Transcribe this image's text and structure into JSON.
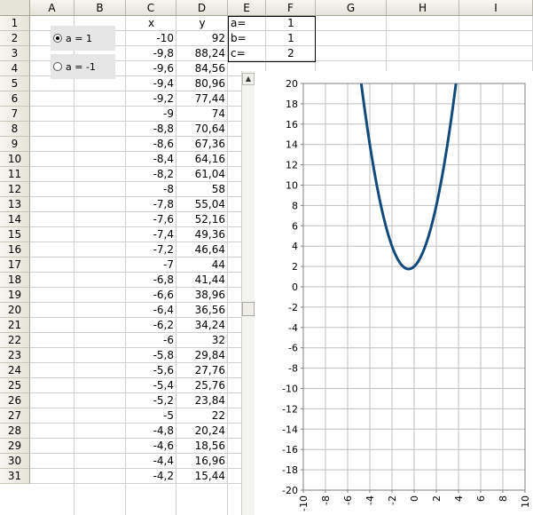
{
  "columns": [
    "A",
    "B",
    "C",
    "D",
    "E",
    "F",
    "G",
    "H",
    "I"
  ],
  "rows": [
    "1",
    "2",
    "3",
    "4",
    "5",
    "6",
    "7",
    "8",
    "9",
    "10",
    "11",
    "12",
    "13",
    "14",
    "15",
    "16",
    "17",
    "18",
    "19",
    "20",
    "21",
    "22",
    "23",
    "24",
    "25",
    "26",
    "27",
    "28",
    "29",
    "30",
    "31"
  ],
  "header_cells": {
    "x": "x",
    "y": "y"
  },
  "params": [
    {
      "label": "a=",
      "value": "1"
    },
    {
      "label": "b=",
      "value": "1"
    },
    {
      "label": "c=",
      "value": "2"
    }
  ],
  "table": {
    "x": [
      "-10",
      "-9,8",
      "-9,6",
      "-9,4",
      "-9,2",
      "-9",
      "-8,8",
      "-8,6",
      "-8,4",
      "-8,2",
      "-8",
      "-7,8",
      "-7,6",
      "-7,4",
      "-7,2",
      "-7",
      "-6,8",
      "-6,6",
      "-6,4",
      "-6,2",
      "-6",
      "-5,8",
      "-5,6",
      "-5,4",
      "-5,2",
      "-5",
      "-4,8",
      "-4,6",
      "-4,4",
      "-4,2"
    ],
    "y": [
      "92",
      "88,24",
      "84,56",
      "80,96",
      "77,44",
      "74",
      "70,64",
      "67,36",
      "64,16",
      "61,04",
      "58",
      "55,04",
      "52,16",
      "49,36",
      "46,64",
      "44",
      "41,44",
      "38,96",
      "36,56",
      "34,24",
      "32",
      "29,84",
      "27,76",
      "25,76",
      "23,84",
      "22",
      "20,24",
      "18,56",
      "16,96",
      "15,44"
    ]
  },
  "radio": [
    {
      "label": "a = 1",
      "checked": true
    },
    {
      "label": "a = -1",
      "checked": false
    }
  ],
  "scrollbar": {
    "up_icon": "triangle-up-icon",
    "down_icon": "triangle-down-icon"
  },
  "chart_data": {
    "type": "line",
    "function": {
      "a": 1,
      "b": 1,
      "c": 2
    },
    "xlim": [
      -10,
      10
    ],
    "ylim": [
      -20,
      20
    ],
    "x_ticks": [
      "-10",
      "-8",
      "-6",
      "-4",
      "-2",
      "0",
      "2",
      "4",
      "6",
      "8",
      "10"
    ],
    "y_ticks": [
      "20",
      "18",
      "16",
      "14",
      "12",
      "10",
      "8",
      "6",
      "4",
      "2",
      "0",
      "-2",
      "-4",
      "-6",
      "-8",
      "-10",
      "-12",
      "-14",
      "-16",
      "-18",
      "-20"
    ],
    "grid": true,
    "line_color": "#124a7e",
    "title": "",
    "xlabel": "",
    "ylabel": ""
  },
  "colors": {
    "header_bg": "#e6e4d9",
    "grid_line": "#d0d0d0",
    "radio_bg": "#e6e6e6"
  }
}
